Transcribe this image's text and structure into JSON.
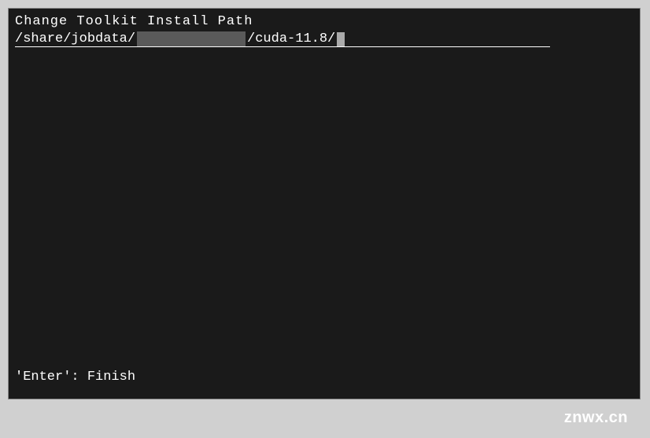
{
  "terminal": {
    "title": "Change Toolkit Install Path",
    "path_prefix": "/share/jobdata/",
    "path_suffix": "/cuda-11.8/",
    "footer": "'Enter': Finish"
  },
  "watermark": "znwx.cn"
}
